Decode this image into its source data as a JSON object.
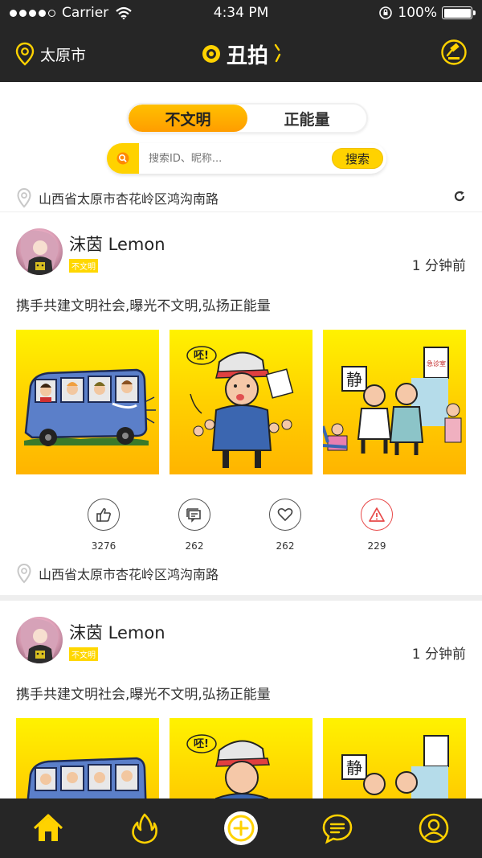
{
  "status_bar": {
    "carrier": "Carrier",
    "time": "4:34 PM",
    "battery": "100%"
  },
  "navbar": {
    "city": "太原市",
    "logo_text": "丑拍",
    "right_icon": "gavel-icon"
  },
  "segment": {
    "options": [
      "不文明",
      "正能量"
    ],
    "active_index": 0
  },
  "search": {
    "placeholder": "搜索ID、昵称...",
    "button": "搜索"
  },
  "location_bar": {
    "address": "山西省太原市杏花岭区鸿沟南路"
  },
  "posts": [
    {
      "user_name": "沫茵 Lemon",
      "tag": "不文明",
      "time": "1 分钟前",
      "text": "携手共建文明社会,曝光不文明,弘扬正能量",
      "images": [
        "bus-cartoon",
        "boy-cartoon",
        "quiet-sign-cartoon"
      ],
      "stats": {
        "likes": "3276",
        "comments": "262",
        "favorites": "262",
        "reports": "229"
      },
      "location": "山西省太原市杏花岭区鸿沟南路"
    },
    {
      "user_name": "沫茵 Lemon",
      "tag": "不文明",
      "time": "1 分钟前",
      "text": "携手共建文明社会,曝光不文明,弘扬正能量",
      "images": [
        "bus-cartoon",
        "boy-cartoon",
        "quiet-sign-cartoon"
      ]
    }
  ],
  "cartoon_text": {
    "boy_shout": "呸!",
    "sign": "静",
    "sign2": "急诊室"
  },
  "tabbar": {
    "items": [
      "home-icon",
      "fire-icon",
      "add-icon",
      "message-icon",
      "profile-icon"
    ],
    "active_index": 0
  },
  "colors": {
    "accent": "#ffd200",
    "dark": "#262626",
    "warn": "#e84a4a"
  }
}
